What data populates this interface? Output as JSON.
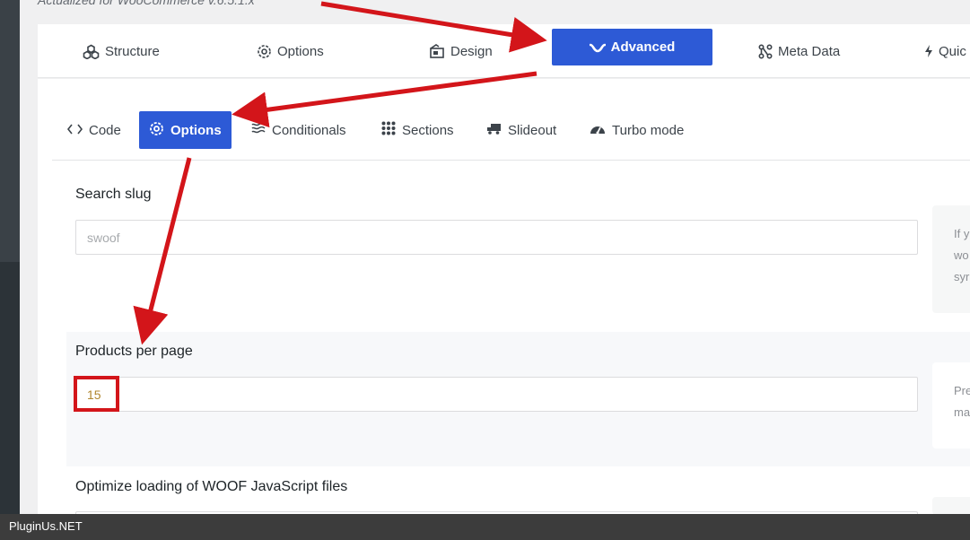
{
  "header": {
    "note": "Actualized for WooCommerce v.6.5.1.x"
  },
  "main_tabs": [
    {
      "label": "Structure",
      "icon": "cubes-icon"
    },
    {
      "label": "Options",
      "icon": "gear-icon"
    },
    {
      "label": "Design",
      "icon": "design-icon"
    },
    {
      "label": "Advanced",
      "icon": "chevron-wave-icon",
      "active": true
    },
    {
      "label": "Meta Data",
      "icon": "network-icon"
    },
    {
      "label": "Quic",
      "icon": "bolt-icon"
    }
  ],
  "sub_tabs": [
    {
      "label": "Code",
      "icon": "code-icon"
    },
    {
      "label": "Options",
      "icon": "gear-icon",
      "active": true
    },
    {
      "label": "Conditionals",
      "icon": "waves-icon"
    },
    {
      "label": "Sections",
      "icon": "grid-dots-icon"
    },
    {
      "label": "Slideout",
      "icon": "truck-icon"
    },
    {
      "label": "Turbo mode",
      "icon": "gauge-icon"
    }
  ],
  "fields": {
    "search_slug": {
      "label": "Search slug",
      "placeholder": "swoof",
      "hint_lines": [
        "If y",
        "wo",
        "syr"
      ]
    },
    "products_per_page": {
      "label": "Products per page",
      "value": "15",
      "hint_lines": [
        "Pre",
        "ma"
      ]
    },
    "optimize_js": {
      "label": "Optimize loading of WOOF JavaScript files"
    }
  },
  "footer": {
    "text": "PluginUs.NET"
  },
  "colors": {
    "accent": "#2d5ad6",
    "annotation_red": "#d3151a",
    "footer_bg": "#3c3c3c"
  }
}
